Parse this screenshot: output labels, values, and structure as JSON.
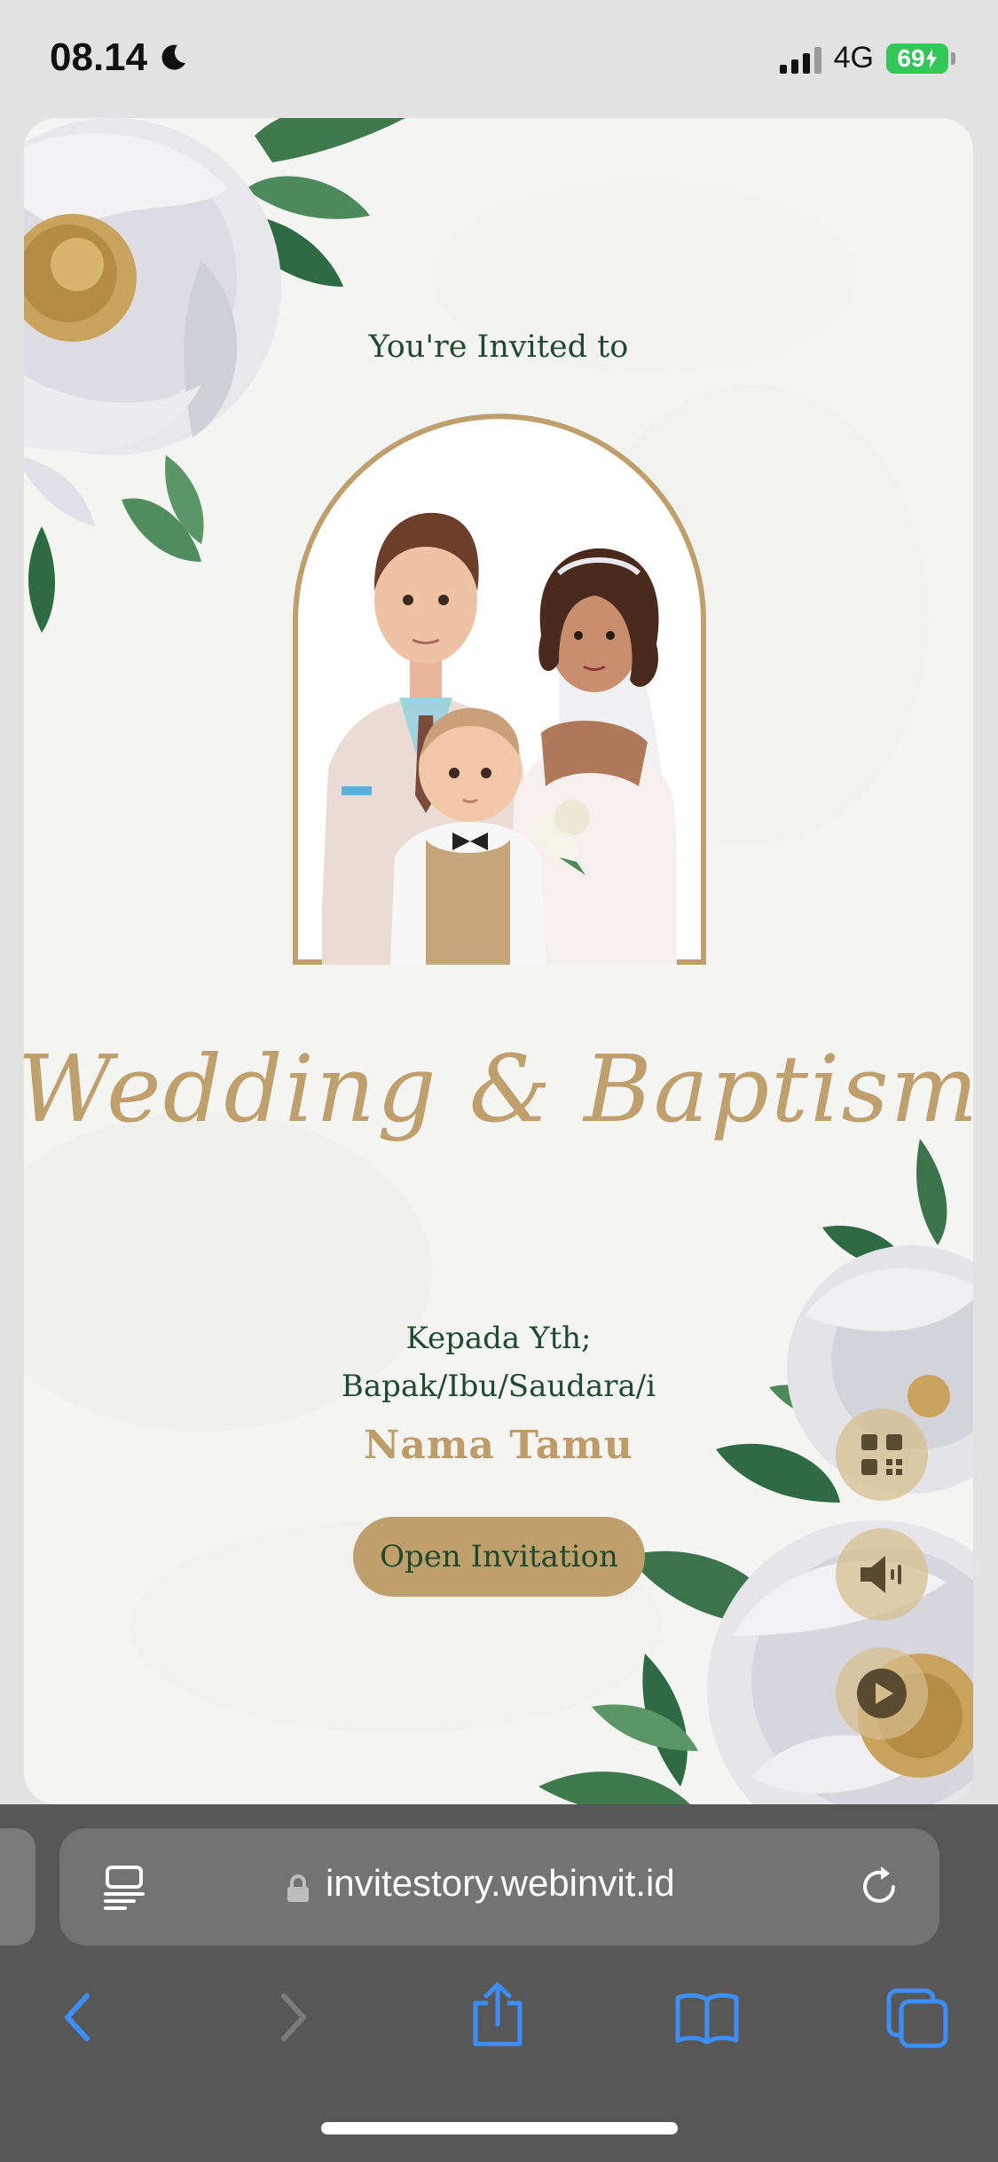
{
  "status_bar": {
    "time": "08.14",
    "network": "4G",
    "battery": "69"
  },
  "invitation": {
    "intro": "You're Invited to",
    "title": "Wedding & Baptism",
    "recipient_line1": "Kepada Yth;",
    "recipient_line2": "Bapak/Ibu/Saudara/i",
    "guest_name": "Nama Tamu",
    "open_button": "Open Invitation",
    "side_buttons": [
      "qr-code-icon",
      "speaker-icon",
      "play-icon"
    ]
  },
  "browser": {
    "url": "invitestory.webinvit.id",
    "toolbar": [
      "back-icon",
      "forward-icon",
      "share-icon",
      "bookmarks-icon",
      "tabs-icon"
    ]
  },
  "colors": {
    "accent_gold": "#bf9f6c",
    "text_green": "#1f4a2e",
    "card_bg": "#f4f4f3",
    "browser_bg": "#575757",
    "link_blue": "#3d8ef7"
  }
}
